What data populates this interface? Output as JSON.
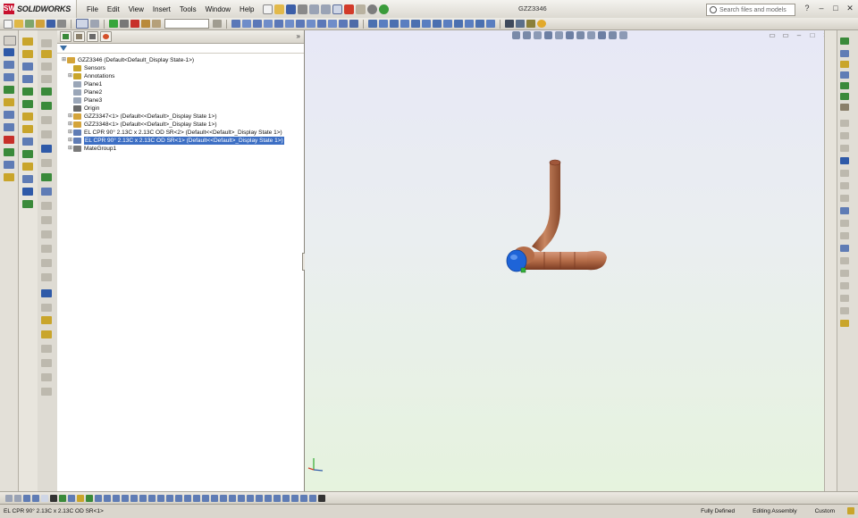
{
  "app": {
    "logo_text": "SOLIDWORKS",
    "document_title": "GZZ3346"
  },
  "menu": [
    "File",
    "Edit",
    "View",
    "Insert",
    "Tools",
    "Window",
    "Help"
  ],
  "search": {
    "placeholder": "Search files and models"
  },
  "feature_tree": {
    "rows": [
      {
        "label": "GZZ3346  (Default<Default_Display State-1>)",
        "icon": "assembly-icon",
        "expandable": true,
        "level": 0,
        "selected": false
      },
      {
        "label": "Sensors",
        "icon": "sensor-icon",
        "expandable": false,
        "level": 1,
        "selected": false
      },
      {
        "label": "Annotations",
        "icon": "annotation-icon",
        "expandable": true,
        "level": 1,
        "selected": false
      },
      {
        "label": "Plane1",
        "icon": "plane-icon",
        "expandable": false,
        "level": 1,
        "selected": false
      },
      {
        "label": "Plane2",
        "icon": "plane-icon",
        "expandable": false,
        "level": 1,
        "selected": false
      },
      {
        "label": "Plane3",
        "icon": "plane-icon",
        "expandable": false,
        "level": 1,
        "selected": false
      },
      {
        "label": "Origin",
        "icon": "origin-icon",
        "expandable": false,
        "level": 1,
        "selected": false
      },
      {
        "label": "GZZ3347<1> (Default<<Default>_Display State 1>)",
        "icon": "subassembly-icon",
        "expandable": true,
        "level": 1,
        "selected": false
      },
      {
        "label": "GZZ3348<1> (Default<<Default>_Display State 1>)",
        "icon": "subassembly-icon",
        "expandable": true,
        "level": 1,
        "selected": false
      },
      {
        "label": "EL CPR 90° 2.13C x 2.13C OD SR<2> (Default<<Default>_Display State 1>)",
        "icon": "part-icon",
        "expandable": true,
        "level": 1,
        "selected": false
      },
      {
        "label": "EL CPR 90° 2.13C x 2.13C OD SR<1> (Default<<Default>_Display State 1>)",
        "icon": "part-icon",
        "expandable": true,
        "level": 1,
        "selected": true
      },
      {
        "label": "MateGroup1",
        "icon": "mates-icon",
        "expandable": true,
        "level": 1,
        "selected": false
      }
    ]
  },
  "status": {
    "selection": "EL CPR 90° 2.13C x 2.13C OD SR<1>",
    "definition": "Fully Defined",
    "mode": "Editing Assembly",
    "units": "Custom"
  },
  "colors": {
    "pipe": "#b8704d",
    "selection_blue": "#1e64d8",
    "tree_selection": "#3d6fc4"
  }
}
